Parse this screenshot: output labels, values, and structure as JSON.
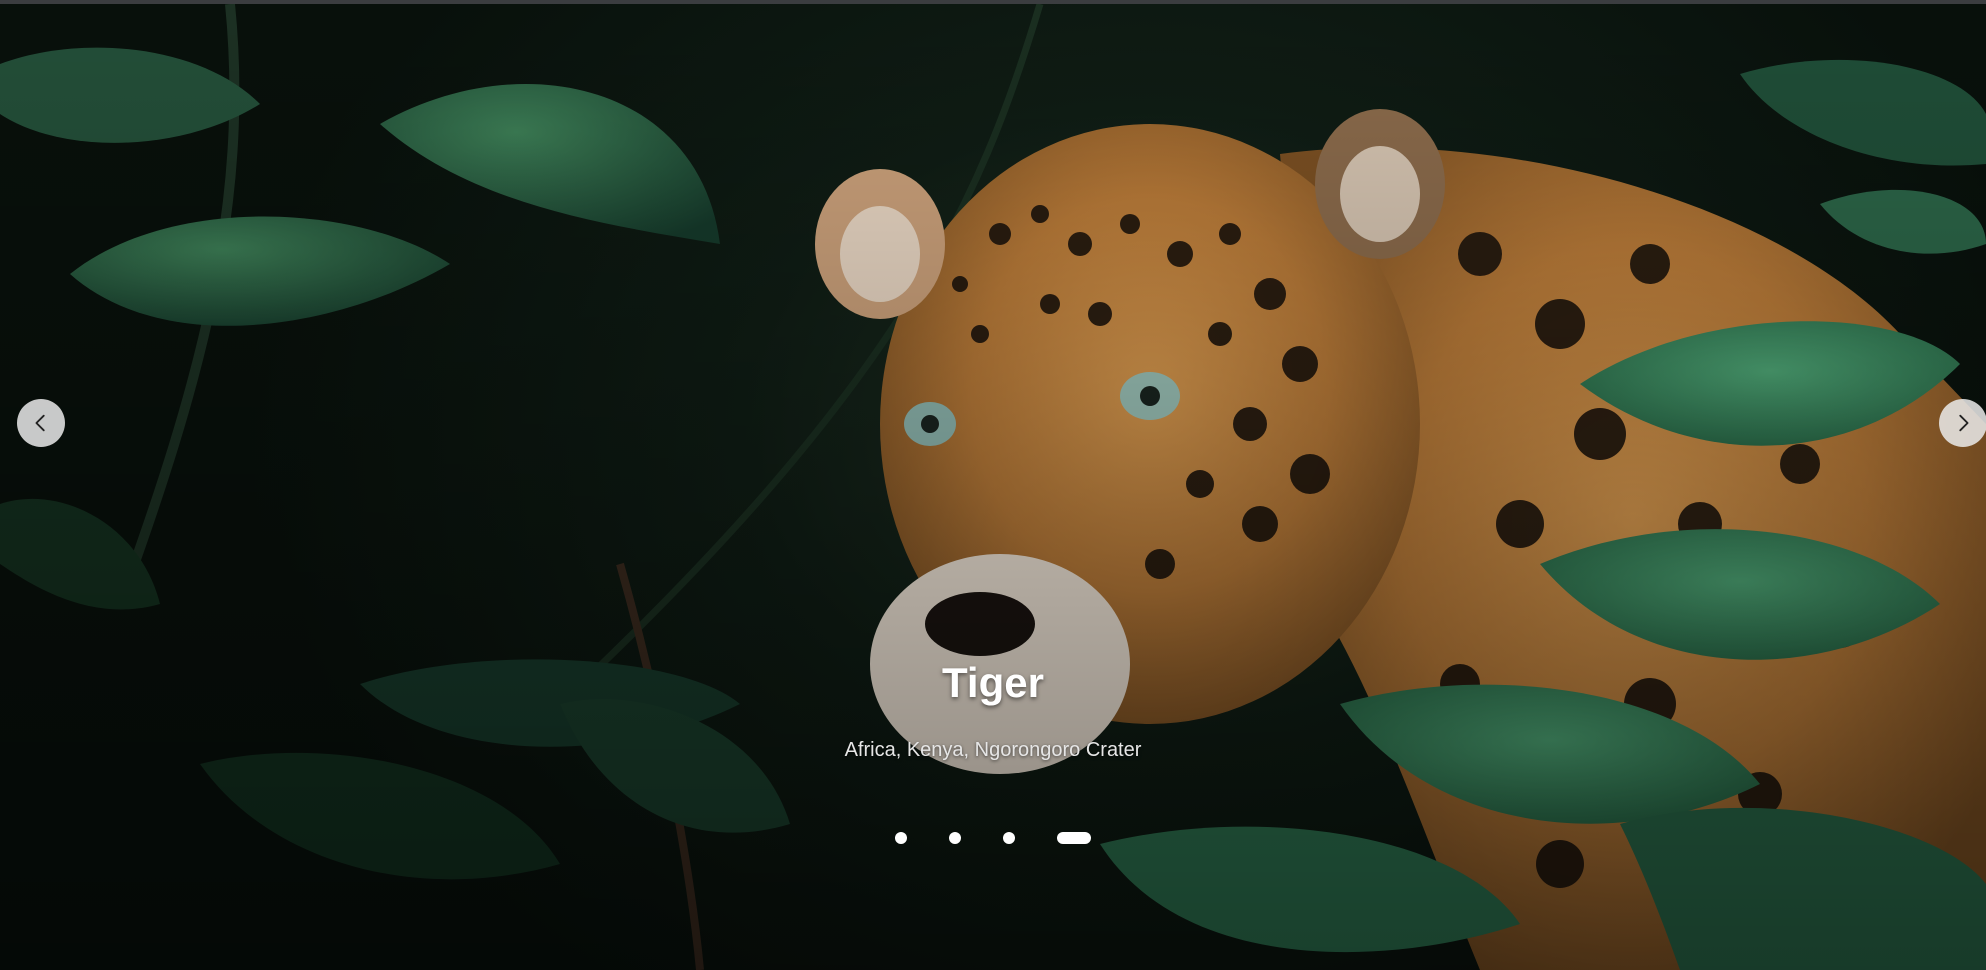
{
  "carousel": {
    "slide": {
      "title": "Tiger",
      "subtitle": "Africa, Kenya, Ngorongoro Crater",
      "image_subject": "leopard-in-jungle-foliage"
    },
    "controls": {
      "prev_icon": "chevron-left-icon",
      "next_icon": "chevron-right-icon"
    },
    "indicators": {
      "count": 4,
      "active_index": 3
    },
    "colors": {
      "caption_text": "#ffffff",
      "arrow_bg": "#ebebeb",
      "indicator": "#ffffff"
    }
  }
}
